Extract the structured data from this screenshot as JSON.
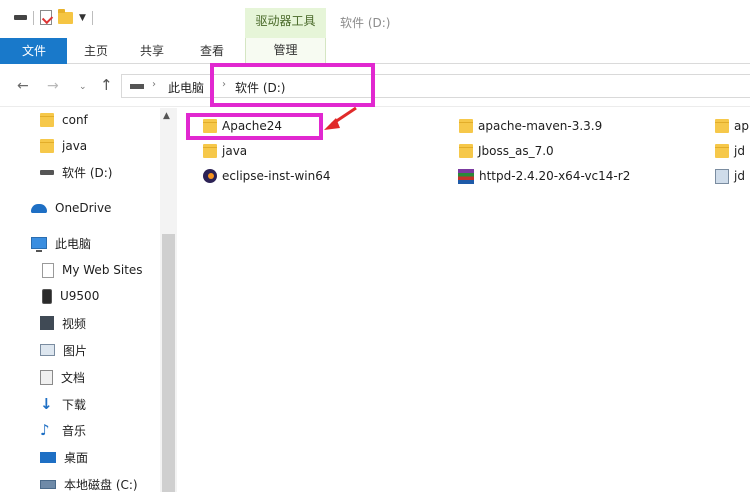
{
  "quick_access": {
    "icons": [
      "drive-icon",
      "properties-icon",
      "new-folder-icon",
      "customize-dropdown-icon"
    ]
  },
  "ribbon": {
    "context_group": "驱动器工具",
    "window_title": "软件 (D:)",
    "tabs": [
      {
        "label": "文件"
      },
      {
        "label": "主页"
      },
      {
        "label": "共享"
      },
      {
        "label": "查看"
      },
      {
        "label": "管理"
      }
    ]
  },
  "address": {
    "crumbs": [
      "此电脑",
      "软件 (D:)"
    ]
  },
  "nav_pane": {
    "items": [
      {
        "label": "conf",
        "icon": "folder-icon"
      },
      {
        "label": "java",
        "icon": "folder-icon"
      },
      {
        "label": "软件 (D:)",
        "icon": "drive-icon"
      },
      {
        "label": "OneDrive",
        "icon": "onedrive-icon"
      },
      {
        "label": "此电脑",
        "icon": "computer-icon"
      },
      {
        "label": "My Web Sites",
        "icon": "document-icon"
      },
      {
        "label": "U9500",
        "icon": "phone-icon"
      },
      {
        "label": "视频",
        "icon": "videos-icon"
      },
      {
        "label": "图片",
        "icon": "pictures-icon"
      },
      {
        "label": "文档",
        "icon": "documents-icon"
      },
      {
        "label": "下载",
        "icon": "downloads-icon"
      },
      {
        "label": "音乐",
        "icon": "music-icon"
      },
      {
        "label": "桌面",
        "icon": "desktop-icon"
      },
      {
        "label": "本地磁盘 (C:)",
        "icon": "hard-drive-icon"
      }
    ]
  },
  "files": {
    "items": [
      {
        "label": "Apache24",
        "icon": "folder-icon"
      },
      {
        "label": "java",
        "icon": "folder-icon"
      },
      {
        "label": "eclipse-inst-win64",
        "icon": "eclipse-icon"
      },
      {
        "label": "apache-maven-3.3.9",
        "icon": "folder-icon"
      },
      {
        "label": "Jboss_as_7.0",
        "icon": "folder-icon"
      },
      {
        "label": "httpd-2.4.20-x64-vc14-r2",
        "icon": "winrar-archive-icon"
      },
      {
        "label": "ap",
        "icon": "folder-icon"
      },
      {
        "label": "jd",
        "icon": "folder-icon"
      },
      {
        "label": "jd",
        "icon": "image-file-icon"
      }
    ]
  },
  "colors": {
    "file_tab": "#1979ca",
    "drive_tools_tab": "#e6f5d8",
    "highlight": "#e128d0",
    "arrow": "#e02a2a"
  }
}
